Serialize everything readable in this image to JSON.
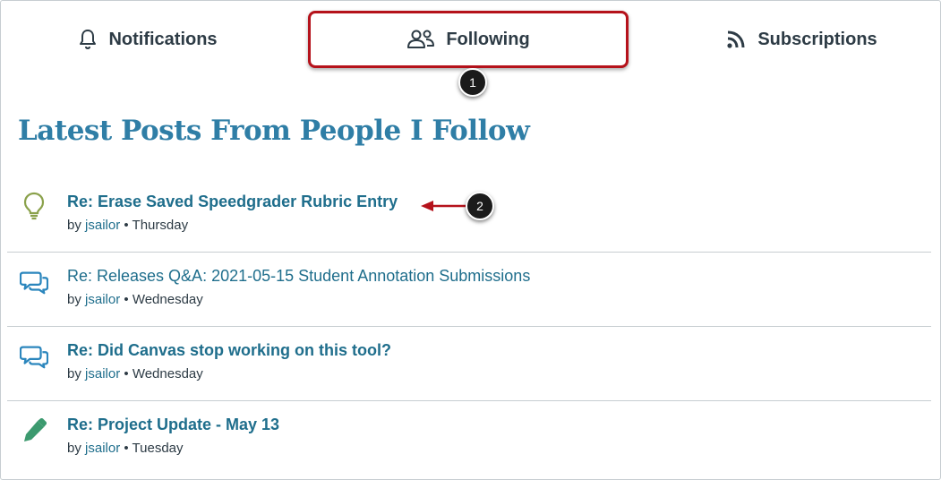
{
  "tabs": [
    {
      "label": "Notifications",
      "icon": "bell-icon"
    },
    {
      "label": "Following",
      "icon": "people-icon",
      "selected": true
    },
    {
      "label": "Subscriptions",
      "icon": "rss-icon"
    }
  ],
  "callouts": [
    "1",
    "2"
  ],
  "page_title": "Latest Posts From People I Follow",
  "posts": [
    {
      "title": "Re: Erase Saved Speedgrader Rubric Entry",
      "by": "by",
      "author": "jsailor",
      "separator": "•",
      "date": "Thursday",
      "icon": "lightbulb-icon",
      "unread": true
    },
    {
      "title": "Re: Releases Q&A: 2021-05-15 Student Annotation Submissions",
      "by": "by",
      "author": "jsailor",
      "separator": "•",
      "date": "Wednesday",
      "icon": "discussion-icon",
      "unread": false
    },
    {
      "title": "Re: Did Canvas stop working on this tool?",
      "by": "by",
      "author": "jsailor",
      "separator": "•",
      "date": "Wednesday",
      "icon": "discussion-icon",
      "unread": true
    },
    {
      "title": "Re: Project Update - May 13",
      "by": "by",
      "author": "jsailor",
      "separator": "•",
      "date": "Tuesday",
      "icon": "pencil-icon",
      "unread": true
    }
  ],
  "colors": {
    "accent": "#2f7ea6",
    "link": "#1f6e8c",
    "highlight_border": "#b5121b",
    "idea_icon": "#8aa14b",
    "discussion_icon": "#2b86bd",
    "pencil_icon": "#3c9a6f"
  }
}
